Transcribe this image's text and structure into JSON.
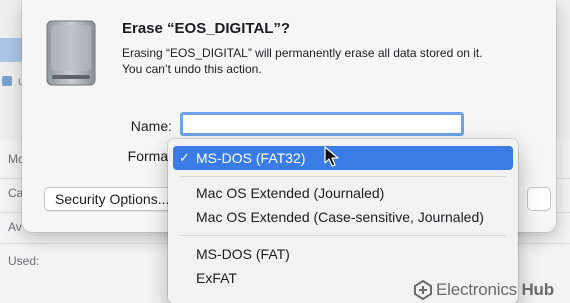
{
  "background": {
    "sidebar_letter": "u",
    "labels": [
      "Mo",
      "Ca",
      "Av",
      "Used:"
    ]
  },
  "dialog": {
    "title": "Erase “EOS_DIGITAL”?",
    "description_line1": "Erasing “EOS_DIGITAL” will permanently erase all data stored on it.",
    "description_line2": "You can’t undo this action.",
    "name_label": "Name:",
    "name_value": "",
    "format_label": "Format",
    "security_button": "Security Options..."
  },
  "format_menu": {
    "selected": "MS-DOS (FAT32)",
    "check_glyph": "✓",
    "groups": [
      [
        "MS-DOS (FAT32)"
      ],
      [
        "Mac OS Extended (Journaled)",
        "Mac OS Extended (Case-sensitive, Journaled)"
      ],
      [
        "MS-DOS (FAT)",
        "ExFAT"
      ]
    ]
  },
  "watermark": {
    "brand_light": "Electronics",
    "brand_bold": "Hub"
  },
  "icons": {
    "disk": "external-drive-icon",
    "cursor": "mouse-pointer-icon",
    "brand": "electronicshub-logo-icon"
  },
  "colors": {
    "selection": "#3a7be6",
    "focus_ring": "#6fa3ea"
  }
}
